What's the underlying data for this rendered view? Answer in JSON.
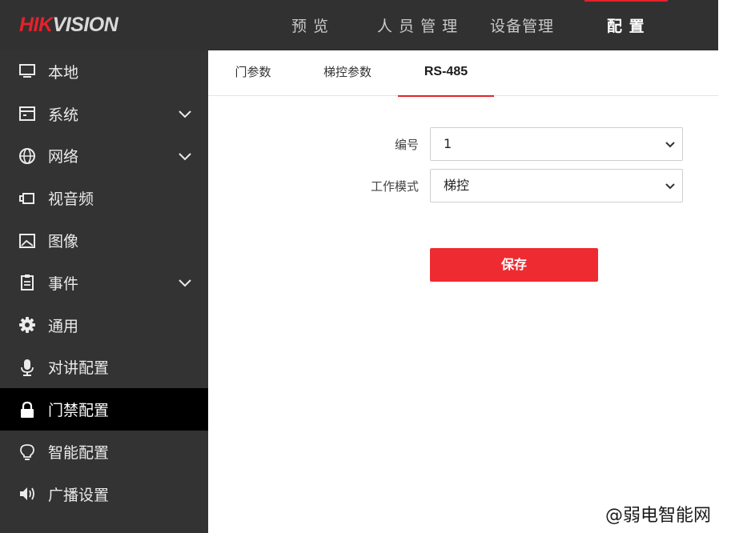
{
  "header": {
    "logo_brand_red": "HIK",
    "logo_brand_rest": "VISION",
    "nav": [
      {
        "label": "预 览",
        "icon": ""
      },
      {
        "label": "人 员 管 理",
        "icon": ""
      },
      {
        "label": "设备管理",
        "icon": ""
      },
      {
        "label": "配 置",
        "icon": ""
      }
    ],
    "active_nav": "配 置"
  },
  "sidebar": {
    "items": [
      {
        "label": "本地",
        "icon": "monitor-icon",
        "expandable": false
      },
      {
        "label": "系统",
        "icon": "window-icon",
        "expandable": true
      },
      {
        "label": "网络",
        "icon": "globe-icon",
        "expandable": true
      },
      {
        "label": "视音频",
        "icon": "video-icon",
        "expandable": false
      },
      {
        "label": "图像",
        "icon": "image-icon",
        "expandable": false
      },
      {
        "label": "事件",
        "icon": "clipboard-icon",
        "expandable": true
      },
      {
        "label": "通用",
        "icon": "gear-icon",
        "expandable": false
      },
      {
        "label": "对讲配置",
        "icon": "microphone-icon",
        "expandable": false
      },
      {
        "label": "门禁配置",
        "icon": "lock-icon",
        "expandable": false
      },
      {
        "label": "智能配置",
        "icon": "lightbulb-icon",
        "expandable": false
      },
      {
        "label": "广播设置",
        "icon": "speaker-icon",
        "expandable": false
      }
    ],
    "active_item": "门禁配置"
  },
  "tabs": {
    "items": [
      "门参数",
      "梯控参数",
      "RS-485"
    ],
    "active": "RS-485"
  },
  "form": {
    "number_label": "编号",
    "number_value": "1",
    "mode_label": "工作模式",
    "mode_value": "梯控"
  },
  "actions": {
    "save_label": "保存"
  },
  "watermark": "@弱电智能网",
  "colors": {
    "accent": "#e3222c",
    "topbar": "#313131",
    "sidebar": "#333333",
    "sidebar_active": "#000000",
    "save_button": "#ee2b30"
  }
}
